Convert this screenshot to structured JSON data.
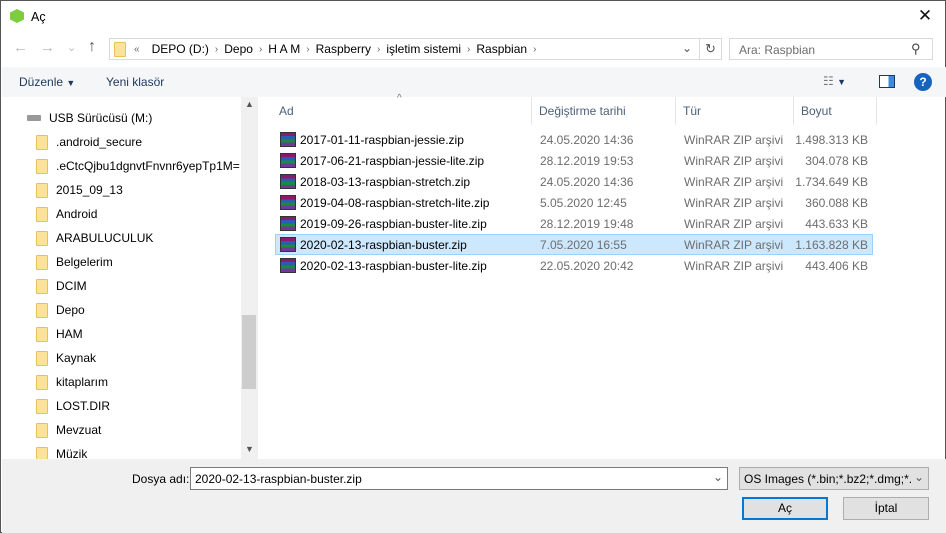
{
  "window": {
    "title": "Aç"
  },
  "nav": {
    "back": "←",
    "forward": "→",
    "recent": "⌄",
    "up": "↑",
    "overflow": "«",
    "breadcrumbs": [
      "DEPO (D:)",
      "Depo",
      "H A M",
      "Raspberry",
      "işletim sistemi",
      "Raspbian"
    ],
    "dropdown": "⌄",
    "refresh": "↻"
  },
  "search": {
    "placeholder": "Ara: Raspbian"
  },
  "toolbar": {
    "organize": "Düzenle",
    "new_folder": "Yeni klasör",
    "help": "?"
  },
  "tree": {
    "drive": "USB Sürücüsü (M:)",
    "folders": [
      ".android_secure",
      ".eCtcQjbu1dgnvtFnvnr6yepTp1M=",
      "2015_09_13",
      "Android",
      "ARABULUCULUK",
      "Belgelerim",
      "DCIM",
      "Depo",
      "HAM",
      "Kaynak",
      "kitaplarım",
      "LOST.DIR",
      "Mevzuat",
      "Müzik"
    ]
  },
  "columns": [
    "Ad",
    "Değiştirme tarihi",
    "Tür",
    "Boyut"
  ],
  "files": [
    {
      "name": "2017-01-11-raspbian-jessie.zip",
      "date": "24.05.2020 14:36",
      "type": "WinRAR ZIP arşivi",
      "size": "1.498.313 KB"
    },
    {
      "name": "2017-06-21-raspbian-jessie-lite.zip",
      "date": "28.12.2019 19:53",
      "type": "WinRAR ZIP arşivi",
      "size": "304.078 KB"
    },
    {
      "name": "2018-03-13-raspbian-stretch.zip",
      "date": "24.05.2020 14:36",
      "type": "WinRAR ZIP arşivi",
      "size": "1.734.649 KB"
    },
    {
      "name": "2019-04-08-raspbian-stretch-lite.zip",
      "date": "5.05.2020 12:45",
      "type": "WinRAR ZIP arşivi",
      "size": "360.088 KB"
    },
    {
      "name": "2019-09-26-raspbian-buster-lite.zip",
      "date": "28.12.2019 19:48",
      "type": "WinRAR ZIP arşivi",
      "size": "443.633 KB"
    },
    {
      "name": "2020-02-13-raspbian-buster.zip",
      "date": "7.05.2020 16:55",
      "type": "WinRAR ZIP arşivi",
      "size": "1.163.828 KB",
      "selected": true
    },
    {
      "name": "2020-02-13-raspbian-buster-lite.zip",
      "date": "22.05.2020 20:42",
      "type": "WinRAR ZIP arşivi",
      "size": "443.406 KB"
    }
  ],
  "footer": {
    "filename_label": "Dosya adı:",
    "filename_value": "2020-02-13-raspbian-buster.zip",
    "filter": "OS Images (*.bin;*.bz2;*.dmg;*.",
    "open": "Aç",
    "cancel": "İptal"
  }
}
